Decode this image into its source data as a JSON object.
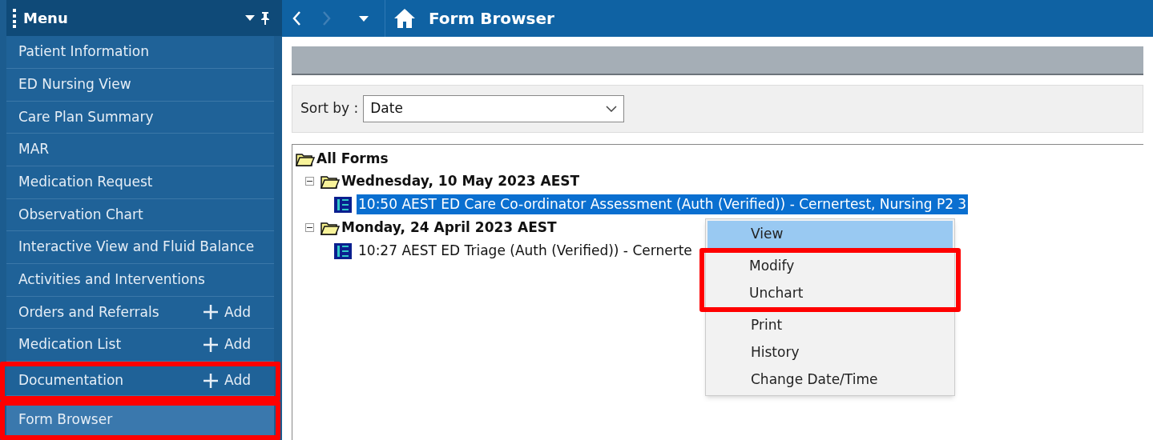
{
  "sidebar": {
    "title": "Menu",
    "items": [
      {
        "label": "Patient Information",
        "selected": false,
        "highlighted": false
      },
      {
        "label": "ED Nursing View",
        "selected": false,
        "highlighted": false
      },
      {
        "label": "Care Plan Summary",
        "selected": false,
        "highlighted": false
      },
      {
        "label": "MAR",
        "selected": false,
        "highlighted": false
      },
      {
        "label": "Medication Request",
        "selected": false,
        "highlighted": false
      },
      {
        "label": "Observation Chart",
        "selected": false,
        "highlighted": false
      },
      {
        "label": "Interactive View and Fluid Balance",
        "selected": false,
        "highlighted": false
      },
      {
        "label": "Activities and Interventions",
        "selected": false,
        "highlighted": false
      },
      {
        "label": "Orders and Referrals",
        "add": "Add",
        "selected": false,
        "highlighted": false
      },
      {
        "label": "Medication List",
        "add": "Add",
        "selected": false,
        "highlighted": false
      },
      {
        "label": "Documentation",
        "add": "Add",
        "selected": false,
        "highlighted": true
      },
      {
        "label": "Form Browser",
        "selected": true,
        "highlighted": true
      }
    ]
  },
  "page_title": "Form Browser",
  "sort": {
    "label": "Sort by :",
    "value": "Date"
  },
  "tree": {
    "label": "All Forms",
    "children": [
      {
        "label": "Wednesday, 10 May 2023 AEST",
        "expanded": true,
        "children": [
          {
            "label": "10:50 AEST ED Care Co-ordinator Assessment (Auth (Verified)) - Cernertest, Nursing P2 3",
            "selected": true
          }
        ]
      },
      {
        "label": "Monday, 24 April 2023 AEST",
        "expanded": true,
        "children": [
          {
            "label": "10:27 AEST ED Triage (Auth (Verified)) - Cernerte",
            "selected": false
          }
        ]
      }
    ]
  },
  "context_menu": [
    {
      "label": "View",
      "hovered": true,
      "highlighted": false
    },
    {
      "label": "Modify",
      "hovered": false,
      "highlighted": true
    },
    {
      "label": "Unchart",
      "hovered": false,
      "highlighted": true
    },
    {
      "label": "Print",
      "hovered": false,
      "highlighted": false
    },
    {
      "label": "History",
      "hovered": false,
      "highlighted": false
    },
    {
      "label": "Change Date/Time",
      "hovered": false,
      "highlighted": false
    }
  ]
}
